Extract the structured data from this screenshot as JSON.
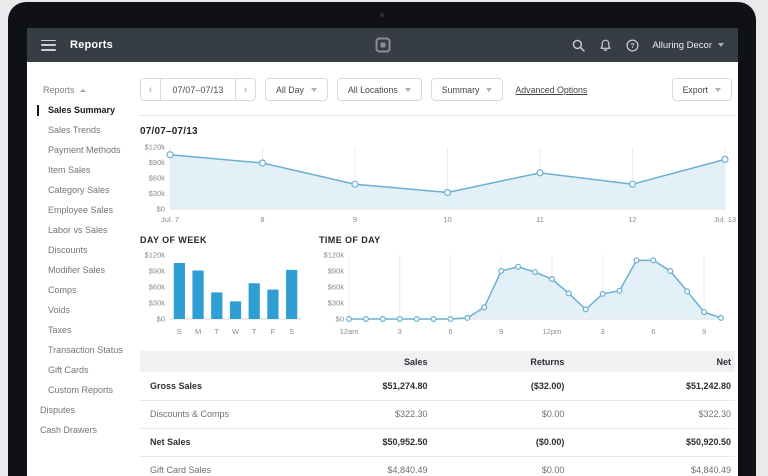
{
  "topbar": {
    "title": "Reports",
    "account": "Alluring Decor",
    "icons": [
      "hamburger",
      "square-logo",
      "search",
      "bell",
      "help",
      "chevron-down"
    ]
  },
  "sidebar": {
    "section_label": "Reports",
    "items": [
      {
        "label": "Sales Summary",
        "level": 1,
        "active": true
      },
      {
        "label": "Sales Trends",
        "level": 1
      },
      {
        "label": "Payment Methods",
        "level": 1
      },
      {
        "label": "Item Sales",
        "level": 1
      },
      {
        "label": "Category Sales",
        "level": 1
      },
      {
        "label": "Employee Sales",
        "level": 1
      },
      {
        "label": "Labor vs Sales",
        "level": 1
      },
      {
        "label": "Discounts",
        "level": 1
      },
      {
        "label": "Modifier Sales",
        "level": 1
      },
      {
        "label": "Comps",
        "level": 1
      },
      {
        "label": "Voids",
        "level": 1
      },
      {
        "label": "Taxes",
        "level": 1
      },
      {
        "label": "Transaction Status",
        "level": 1
      },
      {
        "label": "Gift Cards",
        "level": 1
      },
      {
        "label": "Custom Reports",
        "level": 1
      },
      {
        "label": "Disputes",
        "level": 0
      },
      {
        "label": "Cash Drawers",
        "level": 0
      }
    ]
  },
  "toolbar": {
    "date_range": "07/07–07/13",
    "prev_icon": "‹",
    "next_icon": "›",
    "filters": [
      {
        "label": "All Day"
      },
      {
        "label": "All Locations"
      },
      {
        "label": "Summary"
      }
    ],
    "advanced_options": "Advanced Options",
    "export": "Export"
  },
  "report": {
    "heading": "07/07–07/13"
  },
  "chart_data": [
    {
      "id": "main-sales",
      "type": "area",
      "title": "07/07–07/13",
      "categories": [
        "Jul. 7",
        "8",
        "9",
        "10",
        "11",
        "12",
        "Jul. 13"
      ],
      "values": [
        105000,
        89000,
        48000,
        32000,
        70000,
        48000,
        96000
      ],
      "ylim": [
        0,
        120000
      ],
      "ytick_labels": [
        "$120k",
        "$90k",
        "$60k",
        "$30k",
        "$0"
      ],
      "grid": "vertical-per-category",
      "legend": "none"
    },
    {
      "id": "day-of-week",
      "type": "bar",
      "title": "DAY OF WEEK",
      "categories": [
        "S",
        "M",
        "T",
        "W",
        "T",
        "F",
        "S"
      ],
      "values": [
        105000,
        91000,
        50000,
        33000,
        67000,
        55000,
        92000
      ],
      "ylim": [
        0,
        120000
      ],
      "ytick_labels": [
        "$120k",
        "$90k",
        "$60k",
        "$30k",
        "$0"
      ],
      "legend": "none"
    },
    {
      "id": "time-of-day",
      "type": "area",
      "title": "TIME OF DAY",
      "categories": [
        "12am",
        "1",
        "2",
        "3",
        "4",
        "5",
        "6",
        "7",
        "8",
        "9",
        "10",
        "11",
        "12pm",
        "1",
        "2",
        "3",
        "4",
        "5",
        "6",
        "7",
        "8",
        "9",
        "10"
      ],
      "values": [
        0,
        0,
        0,
        0,
        0,
        0,
        0,
        2000,
        22000,
        90000,
        98000,
        88000,
        75000,
        48000,
        18000,
        47000,
        53000,
        110000,
        110000,
        90000,
        52000,
        13000,
        2000
      ],
      "x_tick_every": 3,
      "ylim": [
        0,
        120000
      ],
      "ytick_labels": [
        "$120k",
        "$90k",
        "$60k",
        "$30k",
        "$0"
      ],
      "grid": "vertical-per-tick",
      "legend": "none"
    }
  ],
  "table": {
    "columns": [
      "",
      "Sales",
      "Returns",
      "Net"
    ],
    "rows": [
      {
        "label": "Gross Sales",
        "bold": true,
        "values": [
          "$51,274.80",
          "($32.00)",
          "$51,242.80"
        ]
      },
      {
        "label": "Discounts & Comps",
        "bold": false,
        "values": [
          "$322.30",
          "$0.00",
          "$322.30"
        ]
      },
      {
        "label": "Net Sales",
        "bold": true,
        "values": [
          "$50,952.50",
          "($0.00)",
          "$50,920.50"
        ]
      },
      {
        "label": "Gift Card Sales",
        "bold": false,
        "values": [
          "$4,840.49",
          "$0.00",
          "$4,840.49"
        ]
      }
    ]
  },
  "colors": {
    "topbar_bg": "#363d44",
    "accent_bar_blue": "#2e9ed3",
    "line_blue": "#69b0d2",
    "area_fill": "#e3f0f8",
    "grid_line": "#ececec",
    "axis_line": "#d8d9da"
  }
}
